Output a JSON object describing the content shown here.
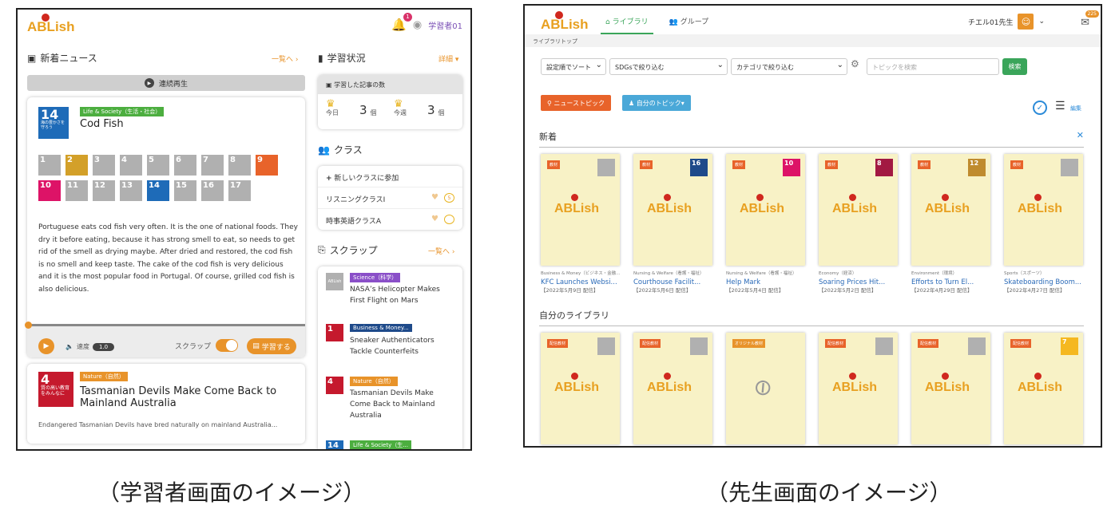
{
  "learner": {
    "logo": "ABLish",
    "notif_count": "1",
    "user": "学習者01",
    "news_title": "新着ニュース",
    "news_link": "一覧へ ›",
    "play_all": "連続再生",
    "article1": {
      "sdg_num": "14",
      "sdg_sub": "海の豊かさを守ろう",
      "category": "Life & Society（生活・社会）",
      "title": "Cod Fish",
      "sdg_tiles": [
        "1",
        "2",
        "3",
        "4",
        "5",
        "6",
        "7",
        "8",
        "9",
        "10",
        "11",
        "12",
        "13",
        "14",
        "15",
        "16",
        "17"
      ],
      "body": "Portuguese eats cod fish very often. It is the one of national foods. They dry it before eating, because it has strong smell to eat, so needs to get rid of the smell as drying maybe. After dried and restored, the cod fish is no smell and keep taste. The cake of the cod fish is very delicious and it is the most popular food in Portugal. Of course, grilled cod fish is also delicious."
    },
    "player": {
      "speed_label": "速度",
      "speed_value": "1.0",
      "scrap_label": "スクラップ",
      "study_button": "学習する"
    },
    "article2": {
      "sdg_num": "4",
      "sdg_sub": "質の高い教育をみんなに",
      "category": "Nature（自然）",
      "title": "Tasmanian Devils Make Come Back to Mainland Australia",
      "summary": "Endangered Tasmanian Devils have bred naturally on mainland Australia..."
    },
    "status_title": "学習状況",
    "status_link": "詳細 ▾",
    "learned_count_label": "学習した記事の数",
    "today_label": "今日",
    "today_value": "3",
    "today_unit": "個",
    "week_label": "今週",
    "week_value": "3",
    "week_unit": "個",
    "class_title": "クラス",
    "class_join": "新しいクラスに参加",
    "classes": [
      "リスニングクラスI",
      "時事英語クラスA"
    ],
    "scrap_title": "スクラップ",
    "scrap_link": "一覧へ ›",
    "scraps": [
      {
        "tag": "Science（科学）",
        "title": "NASA’s Helicopter Makes First Flight on Mars"
      },
      {
        "tag": "Business & Money...",
        "title": "Sneaker Authenticators Tackle Counterfeits"
      },
      {
        "tag": "Nature（自然）",
        "title": "Tasmanian Devils Make Come Back to Mainland Australia"
      },
      {
        "tag": "Life & Society（生...",
        "title": ""
      }
    ],
    "scrap_thumbs": [
      "ABLish",
      "1",
      "4",
      "14"
    ]
  },
  "teacher": {
    "logo": "ABLish",
    "nav_library": "ライブラリ",
    "nav_group": "グループ",
    "user": "チエル01先生",
    "mail_count": "225",
    "breadcrumb": "ライブラリトップ",
    "sort_select": "設定順でソート",
    "sdg_select": "SDGsで絞り込む",
    "cat_select": "カテゴリで絞り込む",
    "search_placeholder": "トピックを検索",
    "search_button": "検索",
    "news_topic_button": "ニューストピック",
    "my_topic_button": "自分のトピック▾",
    "edit_label": "編集",
    "new_section": "新着",
    "new_cards": [
      {
        "badge": "教材",
        "thumb": "",
        "category": "Business & Money（ビジネス・金融...",
        "title": "KFC Launches Websi...",
        "date": "【2022年5月9日 配信】"
      },
      {
        "badge": "教材",
        "thumb": "16",
        "category": "Nursing & Welfare（看護・福祉）",
        "title": "Courthouse Facilit...",
        "date": "【2022年5月6日 配信】"
      },
      {
        "badge": "教材",
        "thumb": "10",
        "category": "Nursing & Welfare（看護・福祉）",
        "title": "Help Mark",
        "date": "【2022年5月4日 配信】"
      },
      {
        "badge": "教材",
        "thumb": "8",
        "category": "Economy（経済）",
        "title": "Soaring Prices Hit...",
        "date": "【2022年5月2日 配信】"
      },
      {
        "badge": "教材",
        "thumb": "12",
        "category": "Environment（環境）",
        "title": "Efforts to Turn El...",
        "date": "【2022年4月29日 配信】"
      },
      {
        "badge": "教材",
        "thumb": "",
        "category": "Sports（スポーツ）",
        "title": "Skateboarding Boom...",
        "date": "【2022年4月27日 配信】"
      }
    ],
    "my_section": "自分のライブラリ",
    "my_cards": [
      {
        "badge": "配信教材",
        "thumb": ""
      },
      {
        "badge": "配信教材",
        "thumb": ""
      },
      {
        "badge": "オリジナル教材",
        "thumb": ""
      },
      {
        "badge": "配信教材",
        "thumb": ""
      },
      {
        "badge": "配信教材",
        "thumb": ""
      },
      {
        "badge": "配信教材",
        "thumb": "7"
      }
    ]
  },
  "captions": {
    "learner": "（学習者画面のイメージ）",
    "teacher": "（先生画面のイメージ）"
  },
  "colors": {
    "orange": "#e8932a",
    "green": "#3aa55a",
    "blue": "#2a8ad8",
    "card_bg": "#f8f2c6"
  }
}
